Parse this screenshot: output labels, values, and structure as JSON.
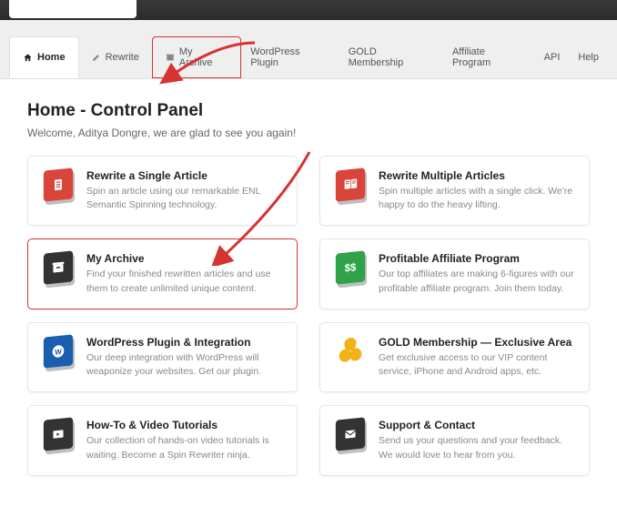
{
  "tabs": {
    "home": "Home",
    "rewrite": "Rewrite",
    "archive": "My Archive",
    "wp": "WordPress Plugin",
    "gold": "GOLD Membership",
    "affiliate": "Affiliate Program",
    "api": "API",
    "help": "Help"
  },
  "page": {
    "title": "Home - Control Panel",
    "welcome": "Welcome, Aditya Dongre, we are glad to see you again!"
  },
  "cards": {
    "rewrite_single": {
      "title": "Rewrite a Single Article",
      "desc": "Spin an article using our remarkable ENL Semantic Spinning technology."
    },
    "rewrite_multi": {
      "title": "Rewrite Multiple Articles",
      "desc": "Spin multiple articles with a single click. We're happy to do the heavy lifting."
    },
    "archive": {
      "title": "My Archive",
      "desc": "Find your finished rewritten articles and use them to create unlimited unique content."
    },
    "affiliate": {
      "title": "Profitable Affiliate Program",
      "desc": "Our top affiliates are making 6-figures with our profitable affiliate program. Join them today."
    },
    "wp": {
      "title": "WordPress Plugin & Integration",
      "desc": "Our deep integration with WordPress will weaponize your websites. Get our plugin."
    },
    "gold": {
      "title": "GOLD Membership — Exclusive Area",
      "desc": "Get exclusive access to our VIP content service, iPhone and Android apps, etc."
    },
    "howto": {
      "title": "How-To & Video Tutorials",
      "desc": "Our collection of hands-on video tutorials is waiting. Become a Spin Rewriter ninja."
    },
    "support": {
      "title": "Support & Contact",
      "desc": "Send us your questions and your feedback. We would love to hear from you."
    }
  },
  "icons": {
    "dollar": "$$"
  }
}
